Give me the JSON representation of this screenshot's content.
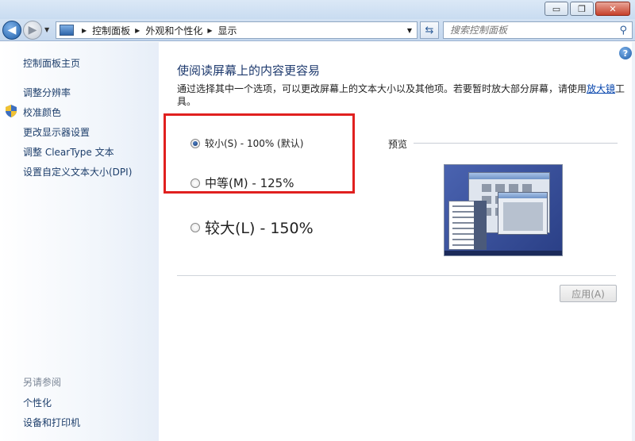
{
  "window": {
    "minimize_glyph": "▭",
    "restore_glyph": "❐",
    "close_glyph": "✕"
  },
  "nav": {
    "breadcrumb": [
      "控制面板",
      "外观和个性化",
      "显示"
    ],
    "search_placeholder": "搜索控制面板"
  },
  "sidebar": {
    "home": "控制面板主页",
    "links": [
      "调整分辨率",
      "校准颜色",
      "更改显示器设置",
      "调整 ClearType 文本",
      "设置自定义文本大小(DPI)"
    ],
    "see_also_title": "另请参阅",
    "see_also": [
      "个性化",
      "设备和打印机"
    ]
  },
  "main": {
    "heading": "使阅读屏幕上的内容更容易",
    "description": "通过选择其中一个选项，可以更改屏幕上的文本大小以及其他项。若要暂时放大部分屏幕，请使用",
    "description_link": "放大镜",
    "description_end": "工具。",
    "options": [
      {
        "label": "较小(S) - 100% (默认)",
        "selected": true
      },
      {
        "label": "中等(M) - 125%",
        "selected": false
      },
      {
        "label": "较大(L) - 150%",
        "selected": false
      }
    ],
    "preview_label": "预览",
    "apply_label": "应用(A)"
  },
  "colors": {
    "highlight_box": "#e0201f",
    "link": "#0645ad",
    "heading": "#1e3a6e"
  }
}
